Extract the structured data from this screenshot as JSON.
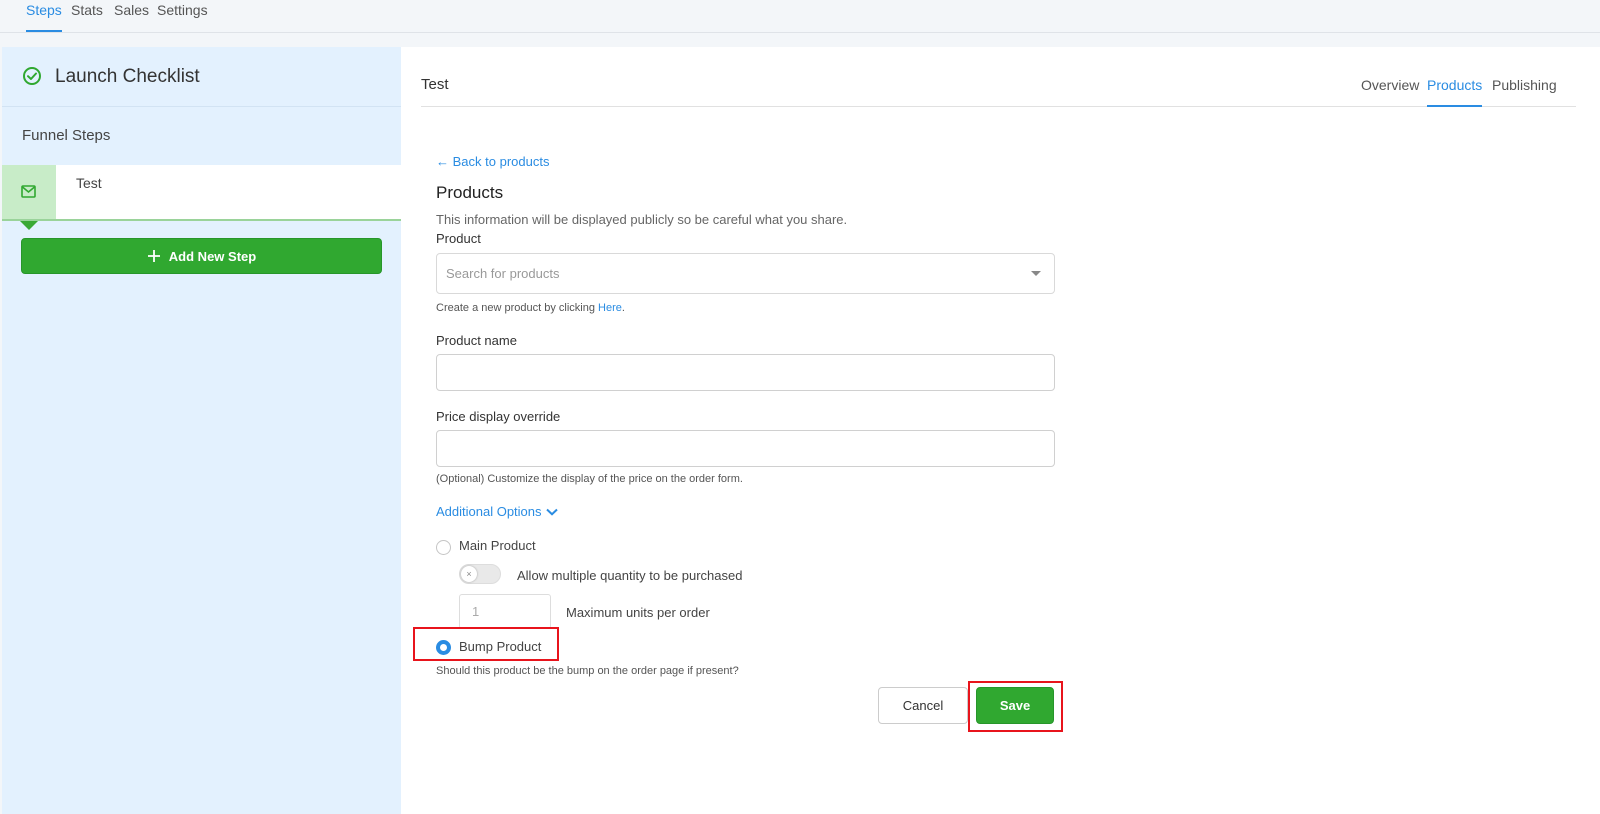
{
  "topnav": {
    "tabs": [
      {
        "label": "Steps",
        "active": true
      },
      {
        "label": "Stats",
        "active": false
      },
      {
        "label": "Sales",
        "active": false
      },
      {
        "label": "Settings",
        "active": false
      }
    ]
  },
  "sidebar": {
    "checklist_title": "Launch Checklist",
    "funnel_steps_title": "Funnel Steps",
    "step_name": "Test",
    "add_step_label": "Add New Step"
  },
  "main": {
    "title": "Test",
    "tabs": [
      {
        "label": "Overview",
        "active": false
      },
      {
        "label": "Products",
        "active": true
      },
      {
        "label": "Publishing",
        "active": false
      }
    ],
    "back_link": "Back to products",
    "section_title": "Products",
    "section_desc": "This information will be displayed publicly so be careful what you share.",
    "product_label": "Product",
    "product_placeholder": "Search for products",
    "create_help_prefix": "Create a new product by clicking ",
    "create_help_link": "Here",
    "create_help_suffix": ".",
    "product_name_label": "Product name",
    "product_name_value": "",
    "price_override_label": "Price display override",
    "price_override_value": "",
    "price_help": "(Optional) Customize the display of the price on the order form.",
    "additional_options": "Additional Options",
    "main_product_label": "Main Product",
    "allow_multiple_label": "Allow multiple quantity to be purchased",
    "allow_multiple_enabled": false,
    "max_units_value": "1",
    "max_units_label": "Maximum units per order",
    "bump_product_label": "Bump Product",
    "bump_help": "Should this product be the bump on the order page if present?",
    "selected_product_type": "Bump Product",
    "cancel_label": "Cancel",
    "save_label": "Save"
  },
  "colors": {
    "accent": "#2a8ce2",
    "success": "#30a830",
    "highlight": "#e8141c",
    "sidebar_bg": "#e3f1fe"
  }
}
